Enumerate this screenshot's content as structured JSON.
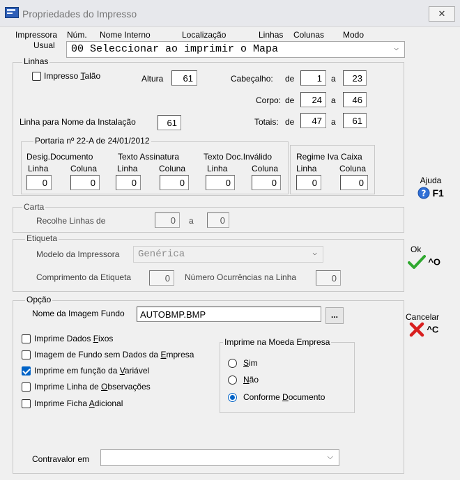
{
  "window": {
    "title": "Propriedades do Impresso",
    "close_glyph": "✕"
  },
  "header": {
    "col_impressora": "Impressora",
    "col_usual": "Usual",
    "col_num": "Núm.",
    "col_nome": "Nome Interno",
    "col_local": "Localização",
    "col_linhas": "Linhas",
    "col_colunas": "Colunas",
    "col_modo": "Modo",
    "printer_value": "00 Seleccionar ao imprimir o Mapa"
  },
  "linhas": {
    "legend": "Linhas",
    "impresso_talao": "Impresso Talão",
    "impresso_talao_checked": false,
    "altura_label": "Altura",
    "altura": "61",
    "cabecalho_label": "Cabeçalho:",
    "de": "de",
    "a": "a",
    "cabecalho_de": "1",
    "cabecalho_a": "23",
    "corpo_label": "Corpo:",
    "corpo_de": "24",
    "corpo_a": "46",
    "totais_label": "Totais:",
    "totais_de": "47",
    "totais_a": "61",
    "linha_nome_label": "Linha para Nome da Instalação",
    "linha_nome": "61"
  },
  "portaria": {
    "legend": "Portaria nº 22-A de 24/01/2012",
    "desig_label": "Desig.Documento",
    "assin_label": "Texto Assinatura",
    "invalido_label": "Texto Doc.Inválido",
    "linha": "Linha",
    "coluna": "Coluna",
    "desig_linha": "0",
    "desig_coluna": "0",
    "assin_linha": "0",
    "assin_coluna": "0",
    "inval_linha": "0",
    "inval_coluna": "0"
  },
  "regime": {
    "label": "Regime Iva Caixa",
    "linha": "Linha",
    "coluna": "Coluna",
    "linha_val": "0",
    "coluna_val": "0"
  },
  "carta": {
    "legend": "Carta",
    "recolhe_label": "Recolhe Linhas de",
    "de_val": "0",
    "a": "a",
    "a_val": "0"
  },
  "etiqueta": {
    "legend": "Etiqueta",
    "modelo_label": "Modelo da Impressora",
    "modelo_value": "Genérica",
    "comprimento_label": "Comprimento da Etiqueta",
    "comprimento": "0",
    "ocorrencias_label": "Número Ocurrências na Linha",
    "ocorrencias": "0"
  },
  "opcao": {
    "legend": "Opção",
    "imagem_label": "Nome da Imagem Fundo",
    "imagem_value": "AUTOBMP.BMP",
    "browse_label": "...",
    "checks": [
      {
        "label": "Imprime Dados Fixos",
        "checked": false
      },
      {
        "label": "Imagem de Fundo sem Dados da Empresa",
        "checked": false
      },
      {
        "label": "Imprime em função da Variável",
        "checked": true
      },
      {
        "label": "Imprime Linha de Observações",
        "checked": false
      },
      {
        "label": "Imprime Ficha Adicional",
        "checked": false
      }
    ],
    "moeda_legend": "Imprime na Moeda Empresa",
    "moeda_options": [
      {
        "label": "Sim",
        "selected": false
      },
      {
        "label": "Não",
        "selected": false
      },
      {
        "label": "Conforme Documento",
        "selected": true
      }
    ],
    "contravalor_label": "Contravalor em",
    "contravalor_value": ""
  },
  "side": {
    "ajuda_label": "Ajuda",
    "ajuda_key": "F1",
    "ajuda_icon": "help-icon",
    "ok_label": "Ok",
    "ok_key": "^O",
    "ok_icon": "checkmark-icon",
    "cancel_label": "Cancelar",
    "cancel_key": "^C",
    "cancel_icon": "x-icon"
  },
  "colors": {
    "titlebar": "#e7e8ec",
    "accent": "#0063c7",
    "ok_green": "#2fa82f",
    "cancel_red": "#d81f1f"
  }
}
